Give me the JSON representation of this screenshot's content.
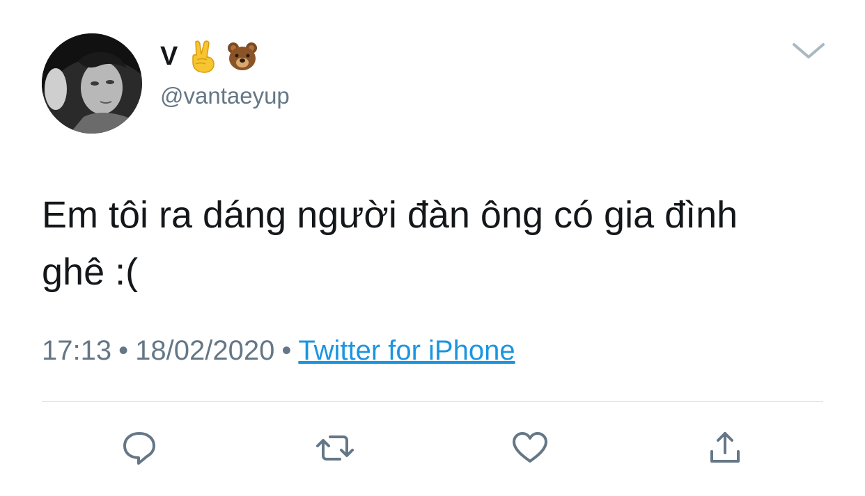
{
  "user": {
    "display_name": "V",
    "emojis": [
      "victory-hand-emoji",
      "bear-face-emoji"
    ],
    "handle": "@vantaeyup"
  },
  "tweet": {
    "text": "Em tôi ra dáng người đàn ông có gia đình ghê :("
  },
  "meta": {
    "time": "17:13",
    "separator": "•",
    "date": "18/02/2020",
    "source": "Twitter for iPhone"
  },
  "actions": [
    "reply-icon",
    "retweet-icon",
    "like-icon",
    "share-icon"
  ],
  "colors": {
    "text": "#14171a",
    "secondary": "#657786",
    "link": "#1b95e0",
    "icon": "#657786",
    "divider": "#d8dde1"
  }
}
